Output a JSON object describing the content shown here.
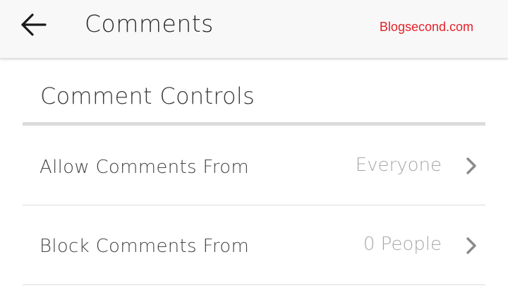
{
  "appbar": {
    "title": "Comments",
    "watermark": "Blogsecond.com",
    "back_icon": "arrow-left-icon"
  },
  "section": {
    "header": "Comment Controls"
  },
  "rows": [
    {
      "label": "Allow Comments From",
      "value": "Everyone",
      "icon": "chevron-right-icon"
    },
    {
      "label": "Block Comments From",
      "value": "0 People",
      "icon": "chevron-right-icon"
    }
  ],
  "colors": {
    "watermark": "#e8202a",
    "appbar_bg": "#f8f8f8",
    "value_text": "#a8a8a8",
    "divider": "#dcdcdc"
  }
}
